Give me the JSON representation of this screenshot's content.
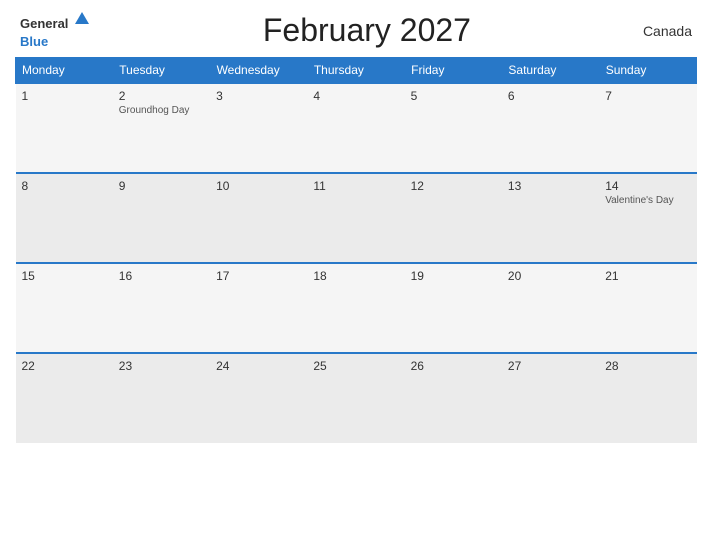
{
  "header": {
    "logo_general": "General",
    "logo_blue": "Blue",
    "title": "February 2027",
    "country": "Canada"
  },
  "days_of_week": [
    "Monday",
    "Tuesday",
    "Wednesday",
    "Thursday",
    "Friday",
    "Saturday",
    "Sunday"
  ],
  "weeks": [
    [
      {
        "day": "1",
        "holiday": ""
      },
      {
        "day": "2",
        "holiday": "Groundhog Day"
      },
      {
        "day": "3",
        "holiday": ""
      },
      {
        "day": "4",
        "holiday": ""
      },
      {
        "day": "5",
        "holiday": ""
      },
      {
        "day": "6",
        "holiday": ""
      },
      {
        "day": "7",
        "holiday": ""
      }
    ],
    [
      {
        "day": "8",
        "holiday": ""
      },
      {
        "day": "9",
        "holiday": ""
      },
      {
        "day": "10",
        "holiday": ""
      },
      {
        "day": "11",
        "holiday": ""
      },
      {
        "day": "12",
        "holiday": ""
      },
      {
        "day": "13",
        "holiday": ""
      },
      {
        "day": "14",
        "holiday": "Valentine's Day"
      }
    ],
    [
      {
        "day": "15",
        "holiday": ""
      },
      {
        "day": "16",
        "holiday": ""
      },
      {
        "day": "17",
        "holiday": ""
      },
      {
        "day": "18",
        "holiday": ""
      },
      {
        "day": "19",
        "holiday": ""
      },
      {
        "day": "20",
        "holiday": ""
      },
      {
        "day": "21",
        "holiday": ""
      }
    ],
    [
      {
        "day": "22",
        "holiday": ""
      },
      {
        "day": "23",
        "holiday": ""
      },
      {
        "day": "24",
        "holiday": ""
      },
      {
        "day": "25",
        "holiday": ""
      },
      {
        "day": "26",
        "holiday": ""
      },
      {
        "day": "27",
        "holiday": ""
      },
      {
        "day": "28",
        "holiday": ""
      }
    ]
  ]
}
